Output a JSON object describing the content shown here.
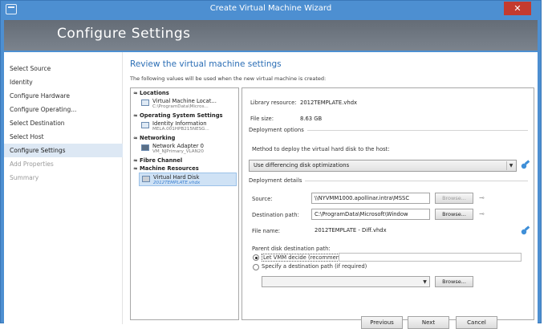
{
  "window": {
    "title": "Create Virtual Machine Wizard",
    "close_label": "✕"
  },
  "banner": {
    "title": "Configure Settings"
  },
  "nav": {
    "items": [
      {
        "label": "Select Source"
      },
      {
        "label": "Identity"
      },
      {
        "label": "Configure Hardware"
      },
      {
        "label": "Configure Operating..."
      },
      {
        "label": "Select Destination"
      },
      {
        "label": "Select Host"
      },
      {
        "label": "Configure Settings"
      },
      {
        "label": "Add Properties"
      },
      {
        "label": "Summary"
      }
    ]
  },
  "main": {
    "heading": "Review the virtual machine settings",
    "subheading": "The following values will be used when the new virtual machine is created:"
  },
  "tree": {
    "categories": [
      {
        "mark": "≈",
        "label": "Locations"
      },
      {
        "mark": "≈",
        "label": "Operating System Settings"
      },
      {
        "mark": "≈",
        "label": "Networking"
      },
      {
        "mark": "≈",
        "label": "Fibre Channel"
      },
      {
        "mark": "≈",
        "label": "Machine Resources"
      }
    ],
    "items": [
      {
        "name": "Virtual Machine Locat...",
        "sub": "C:\\ProgramData\\Micros..."
      },
      {
        "name": "Identity Information",
        "sub": "MELA.001HPB215NESG..."
      },
      {
        "name": "Network Adapter 0",
        "sub": "VM_NJPrimary_VLAN20"
      },
      {
        "name": "Virtual Hard Disk",
        "sub": "2012TEMPLATE.vhdx"
      }
    ]
  },
  "details": {
    "library_label": "Library resource:",
    "library_value": "2012TEMPLATE.vhdx",
    "filesize_label": "File size:",
    "filesize_value": "8.63 GB",
    "deployment_options_label": "Deployment options",
    "method_label": "Method to deploy the virtual hard disk to the host:",
    "method_value": "Use differencing disk optimizations",
    "deployment_details_label": "Deployment details",
    "source_label": "Source:",
    "source_value": "\\\\NYVMM1000.apollinar.intra\\MSSC",
    "browse_label": "Browse...",
    "dest_path_label": "Destination path:",
    "dest_path_value": "C:\\ProgramData\\Microsoft\\Window",
    "file_name_label": "File name:",
    "file_name_value": "2012TEMPLATE - Diff.vhdx",
    "parent_disk_label": "Parent disk destination path:",
    "radio_vmm": "Let VMM decide (recommended)",
    "radio_specify": "Specify a destination path (if required)",
    "specify_path_value": ""
  },
  "footer": {
    "previous": "Previous",
    "next": "Next",
    "cancel": "Cancel"
  }
}
